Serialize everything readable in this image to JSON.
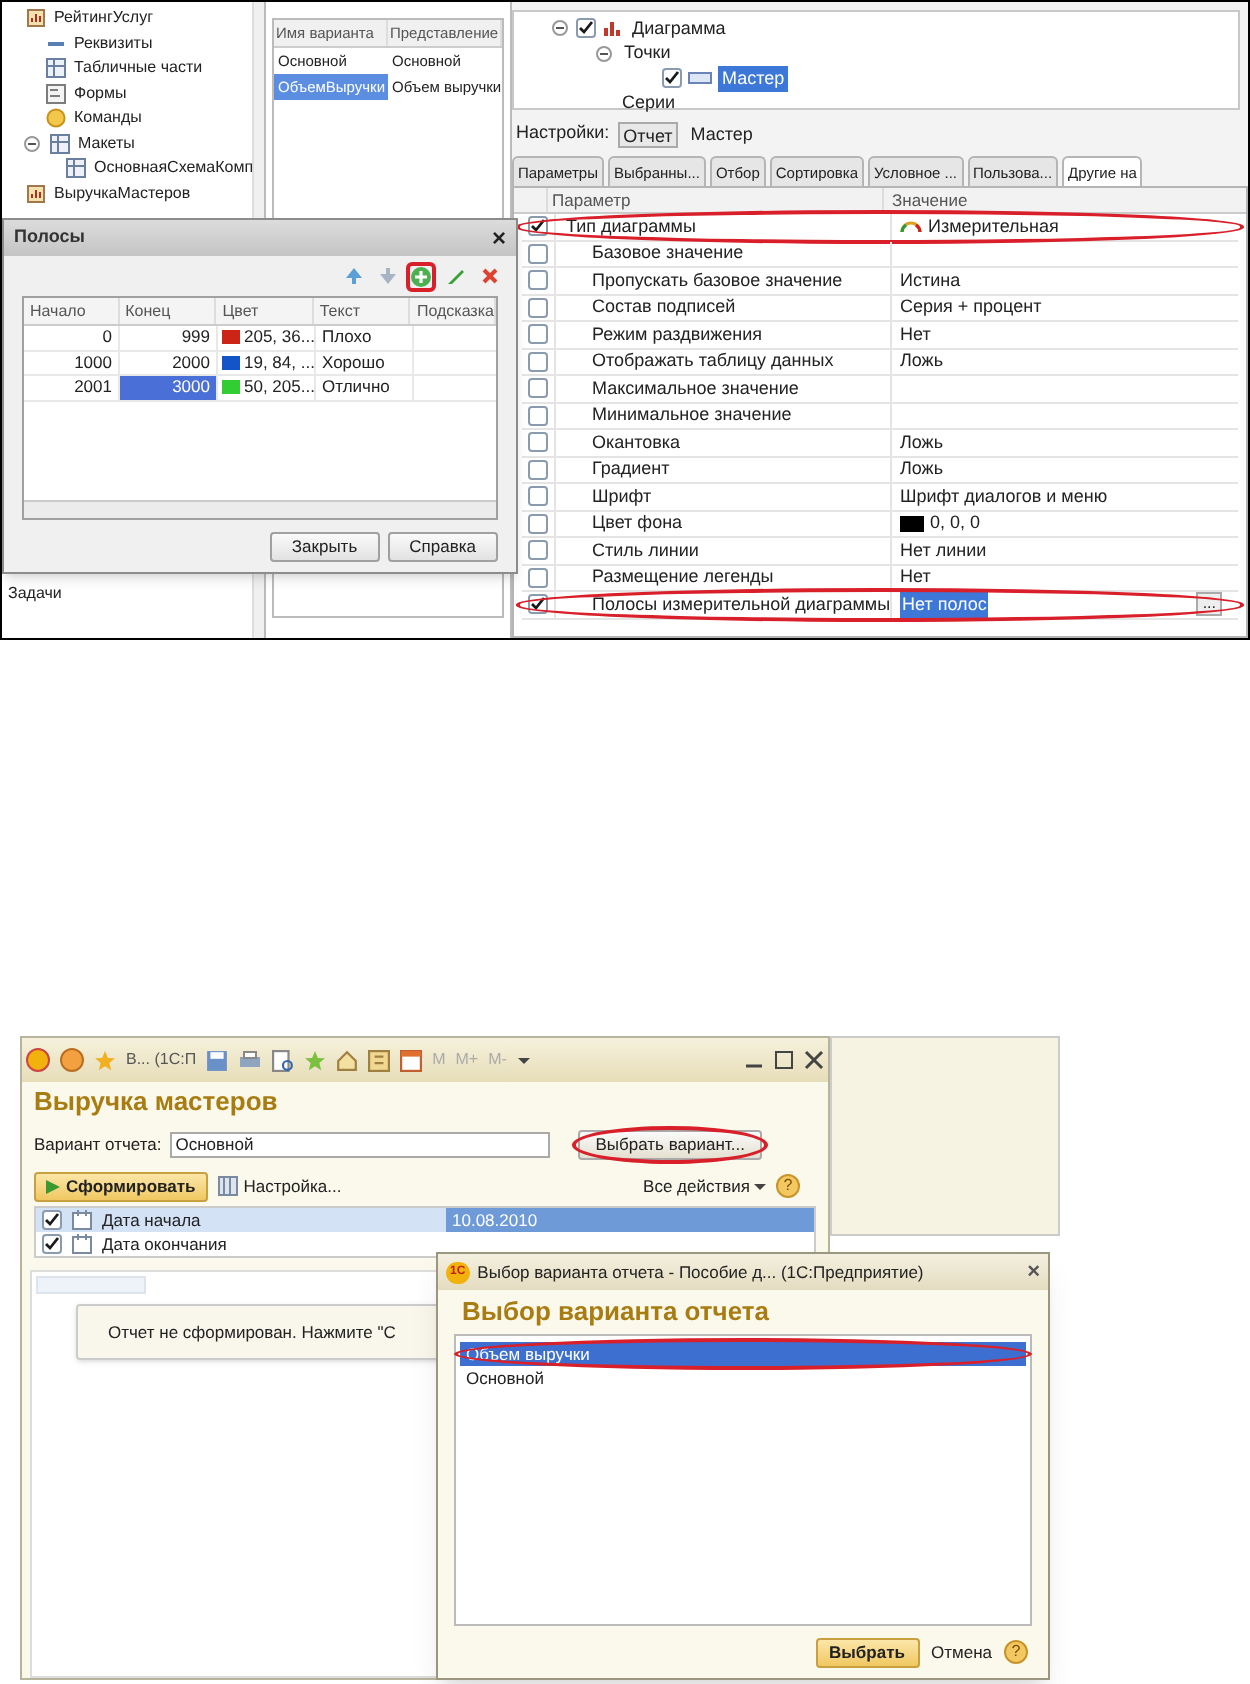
{
  "top_screenshot": {
    "metadata_tree": [
      {
        "label": "РейтингУслуг",
        "kind": "report",
        "children": [
          {
            "label": "Реквизиты",
            "kind": "attributes"
          },
          {
            "label": "Табличные части",
            "kind": "tables"
          },
          {
            "label": "Формы",
            "kind": "forms"
          },
          {
            "label": "Команды",
            "kind": "commands"
          },
          {
            "label": "Макеты",
            "kind": "templates",
            "expanded": true,
            "children": [
              {
                "label": "ОсновнаяСхемаКомп",
                "kind": "template"
              }
            ]
          }
        ]
      },
      {
        "label": "ВыручкаМастеров",
        "kind": "report"
      }
    ],
    "tree_bottom_item": "Задачи",
    "variants_table": {
      "columns": [
        "Имя варианта",
        "Представление"
      ],
      "rows": [
        {
          "cells": [
            "Основной",
            "Основной"
          ],
          "selected": false
        },
        {
          "cells": [
            "ОбъемВыручки",
            "Объем выручки"
          ],
          "selected": true
        }
      ]
    },
    "structure_tree": [
      {
        "label": "Диаграмма",
        "kind": "chart",
        "checked": true,
        "expanded": true,
        "selected": false,
        "children": [
          {
            "label": "Точки",
            "expanded": true,
            "selected": false,
            "children": [
              {
                "label": "Мастер",
                "kind": "group",
                "checked": true,
                "selected": true
              }
            ]
          },
          {
            "label": "Серии",
            "selected": false
          }
        ]
      }
    ],
    "settings_label": "Настройки:",
    "settings_tabs": [
      {
        "label": "Отчет",
        "selected": true
      },
      {
        "label": "Мастер",
        "selected": false
      }
    ],
    "tabs": [
      {
        "label": "Параметры",
        "selected": false
      },
      {
        "label": "Выбранны...",
        "selected": false
      },
      {
        "label": "Отбор",
        "selected": false
      },
      {
        "label": "Сортировка",
        "selected": false
      },
      {
        "label": "Условное ...",
        "selected": false
      },
      {
        "label": "Пользова...",
        "selected": false
      },
      {
        "label": "Другие на",
        "selected": true
      }
    ],
    "params_table": {
      "columns": [
        "Параметр",
        "Значение"
      ],
      "rows": [
        {
          "name": "Тип диаграммы",
          "value": "Измерительная",
          "kind": "gauge",
          "checked": true,
          "annotated": true,
          "children": [
            {
              "name": "Базовое значение",
              "kind": "text",
              "checked": false
            },
            {
              "name": "Пропускать базовое значение",
              "value": "Истина",
              "kind": "text",
              "checked": false
            },
            {
              "name": "Состав подписей",
              "value": "Серия + процент",
              "kind": "text",
              "checked": false
            },
            {
              "name": "Режим раздвижения",
              "value": "Нет",
              "kind": "text",
              "checked": false
            },
            {
              "name": "Отображать таблицу данных",
              "value": "Ложь",
              "kind": "text",
              "checked": false
            },
            {
              "name": "Максимальное значение",
              "kind": "text",
              "checked": false
            },
            {
              "name": "Минимальное значение",
              "kind": "text",
              "checked": false
            },
            {
              "name": "Окантовка",
              "value": "Ложь",
              "kind": "text",
              "checked": false
            },
            {
              "name": "Градиент",
              "value": "Ложь",
              "kind": "text",
              "checked": false
            },
            {
              "name": "Шрифт",
              "value": "Шрифт диалогов и меню",
              "kind": "text",
              "checked": false
            },
            {
              "name": "Цвет фона",
              "value": "0, 0, 0",
              "kind": "color",
              "color": "#000000",
              "checked": false
            },
            {
              "name": "Стиль линии",
              "value": "Нет линии",
              "kind": "text",
              "checked": false
            },
            {
              "name": "Размещение легенды",
              "value": "Нет",
              "kind": "text",
              "checked": false
            },
            {
              "name": "Полосы измерительной диаграммы",
              "value": "Нет полос",
              "kind": "choice",
              "button": "...",
              "checked": true,
              "annotated": true
            }
          ]
        }
      ]
    },
    "bands_dialog": {
      "title": "Полосы",
      "close": "×",
      "toolbar": [
        {
          "kind": "up",
          "annotated": false
        },
        {
          "kind": "down",
          "annotated": false
        },
        {
          "kind": "add",
          "annotated": true
        },
        {
          "kind": "edit",
          "annotated": false
        },
        {
          "kind": "delete",
          "annotated": false
        }
      ],
      "columns": [
        "Начало",
        "Конец",
        "Цвет",
        "Текст",
        "Подсказка"
      ],
      "rows": [
        {
          "start": "0",
          "end": "999",
          "color": "#cd2418",
          "color_text": "205, 36...",
          "text": "Плохо",
          "end_selected": false
        },
        {
          "start": "1000",
          "end": "2000",
          "color": "#1354c8",
          "color_text": "19, 84, ...",
          "text": "Хорошо",
          "end_selected": false
        },
        {
          "start": "2001",
          "end": "3000",
          "color": "#32cd32",
          "color_text": "50, 205...",
          "text": "Отлично",
          "end_selected": true
        }
      ],
      "buttons": [
        "Закрыть",
        "Справка"
      ]
    }
  },
  "bottom_screenshot": {
    "window_title": "В... (1С:П",
    "memory_buttons": [
      "M",
      "M+",
      "M-"
    ],
    "heading": "Выручка мастеров",
    "variant_label": "Вариант отчета:",
    "variant_value": "Основной",
    "choose_button": {
      "label": "Выбрать вариант...",
      "annotated": true
    },
    "generate_button": "Сформировать",
    "settings_button": "Настройка...",
    "all_actions": "Все действия",
    "help": "?",
    "params": [
      {
        "label": "Дата начала",
        "checked": true,
        "value": "10.08.2010",
        "selected": true
      },
      {
        "label": "Дата окончания",
        "checked": true,
        "selected": false
      }
    ],
    "message": "Отчет не сформирован. Нажмите \"С",
    "dialog": {
      "title": "Выбор варианта отчета - Пособие д... (1С:Предприятие)",
      "close": "×",
      "logo": "1С",
      "heading": "Выбор варианта отчета",
      "items": [
        {
          "label": "Объем выручки",
          "selected": true,
          "annotated": true
        },
        {
          "label": "Основной",
          "selected": false,
          "annotated": false
        }
      ],
      "select_button": "Выбрать",
      "cancel_button": "Отмена",
      "help": "?"
    }
  }
}
